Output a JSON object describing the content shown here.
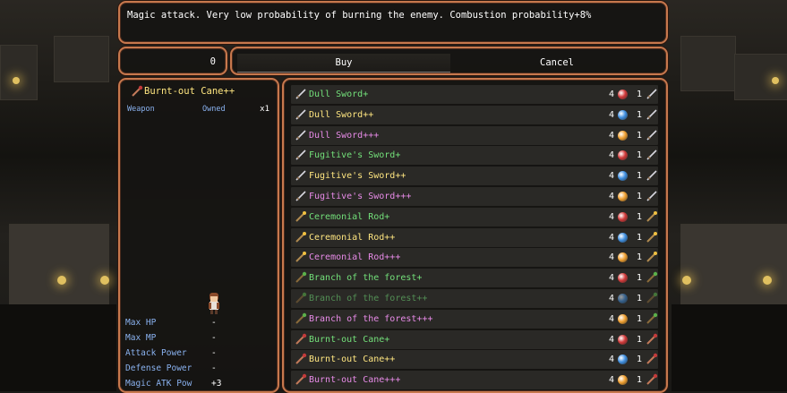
{
  "help_text": "Magic attack. Very low probability of burning the enemy. Combustion probability+8%",
  "number_value": "0",
  "commands": {
    "buy": "Buy",
    "cancel": "Cancel"
  },
  "status": {
    "item_name": "Burnt-out Cane++",
    "type_label": "Weapon",
    "owned_label": "Owned",
    "owned_count": "x1",
    "stats": [
      {
        "label": "Max HP",
        "value": "-"
      },
      {
        "label": "Max MP",
        "value": "-"
      },
      {
        "label": "Attack Power",
        "value": "-"
      },
      {
        "label": "Defense Power",
        "value": "-"
      },
      {
        "label": "Magic ATK Pow",
        "value": "+3"
      }
    ]
  },
  "colors": {
    "frame": "#c7784d",
    "plus_one": "#73e07a",
    "plus_two": "#ffe680",
    "plus_three": "#e88be8",
    "gem_red": "#d23a3a",
    "gem_blue": "#3f8fe0",
    "gem_orange": "#f0a030"
  },
  "items": [
    {
      "name": "Dull Sword+",
      "price": "4",
      "qty": "1",
      "gem": "red",
      "tier": "green",
      "icon": "sword-icon"
    },
    {
      "name": "Dull Sword++",
      "price": "4",
      "qty": "1",
      "gem": "blue",
      "tier": "yellow",
      "icon": "sword-icon"
    },
    {
      "name": "Dull Sword+++",
      "price": "4",
      "qty": "1",
      "gem": "orange",
      "tier": "pink",
      "icon": "sword-icon"
    },
    {
      "name": "Fugitive's Sword+",
      "price": "4",
      "qty": "1",
      "gem": "red",
      "tier": "green",
      "icon": "sword-icon"
    },
    {
      "name": "Fugitive's Sword++",
      "price": "4",
      "qty": "1",
      "gem": "blue",
      "tier": "yellow",
      "icon": "sword-icon"
    },
    {
      "name": "Fugitive's Sword+++",
      "price": "4",
      "qty": "1",
      "gem": "orange",
      "tier": "pink",
      "icon": "sword-icon"
    },
    {
      "name": "Ceremonial Rod+",
      "price": "4",
      "qty": "1",
      "gem": "red",
      "tier": "green",
      "icon": "rod-icon"
    },
    {
      "name": "Ceremonial Rod++",
      "price": "4",
      "qty": "1",
      "gem": "blue",
      "tier": "yellow",
      "icon": "rod-icon"
    },
    {
      "name": "Ceremonial Rod+++",
      "price": "4",
      "qty": "1",
      "gem": "orange",
      "tier": "pink",
      "icon": "rod-icon"
    },
    {
      "name": "Branch of the forest+",
      "price": "4",
      "qty": "1",
      "gem": "red",
      "tier": "green",
      "icon": "branch-icon"
    },
    {
      "name": "Branch of the forest++",
      "price": "4",
      "qty": "1",
      "gem": "blue",
      "tier": "green-dim",
      "icon": "branch-icon"
    },
    {
      "name": "Branch of the forest+++",
      "price": "4",
      "qty": "1",
      "gem": "orange",
      "tier": "pink",
      "icon": "branch-icon"
    },
    {
      "name": "Burnt-out Cane+",
      "price": "4",
      "qty": "1",
      "gem": "red",
      "tier": "green",
      "icon": "cane-icon"
    },
    {
      "name": "Burnt-out Cane++",
      "price": "4",
      "qty": "1",
      "gem": "blue",
      "tier": "yellow",
      "icon": "cane-icon"
    },
    {
      "name": "Burnt-out Cane+++",
      "price": "4",
      "qty": "1",
      "gem": "orange",
      "tier": "pink",
      "icon": "cane-icon"
    }
  ]
}
